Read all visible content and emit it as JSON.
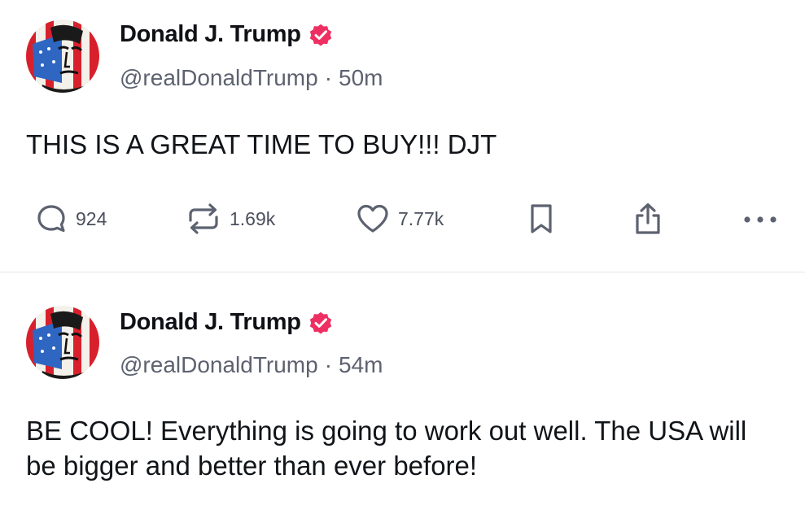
{
  "posts": [
    {
      "author": {
        "display_name": "Donald J. Trump",
        "handle": "@realDonaldTrump",
        "verified_icon": "verified-badge-icon",
        "verified_color": "#ee2f62"
      },
      "separator": "·",
      "timestamp": "50m",
      "body": "THIS IS A GREAT TIME TO BUY!!! DJT",
      "actions": {
        "replies": "924",
        "retruths": "1.69k",
        "likes": "7.77k"
      }
    },
    {
      "author": {
        "display_name": "Donald J. Trump",
        "handle": "@realDonaldTrump",
        "verified_icon": "verified-badge-icon",
        "verified_color": "#ee2f62"
      },
      "separator": "·",
      "timestamp": "54m",
      "body": "BE COOL! Everything is going to work out well. The USA will be bigger and better than ever before!"
    }
  ],
  "icons": {
    "reply": "reply-icon",
    "retruth": "retruth-icon",
    "like": "heart-icon",
    "bookmark": "bookmark-icon",
    "share": "share-icon",
    "more": "more-options-icon"
  },
  "colors": {
    "text": "#111418",
    "muted": "#5d6270",
    "divider": "#e6e7eb",
    "verified": "#ee2f62"
  }
}
